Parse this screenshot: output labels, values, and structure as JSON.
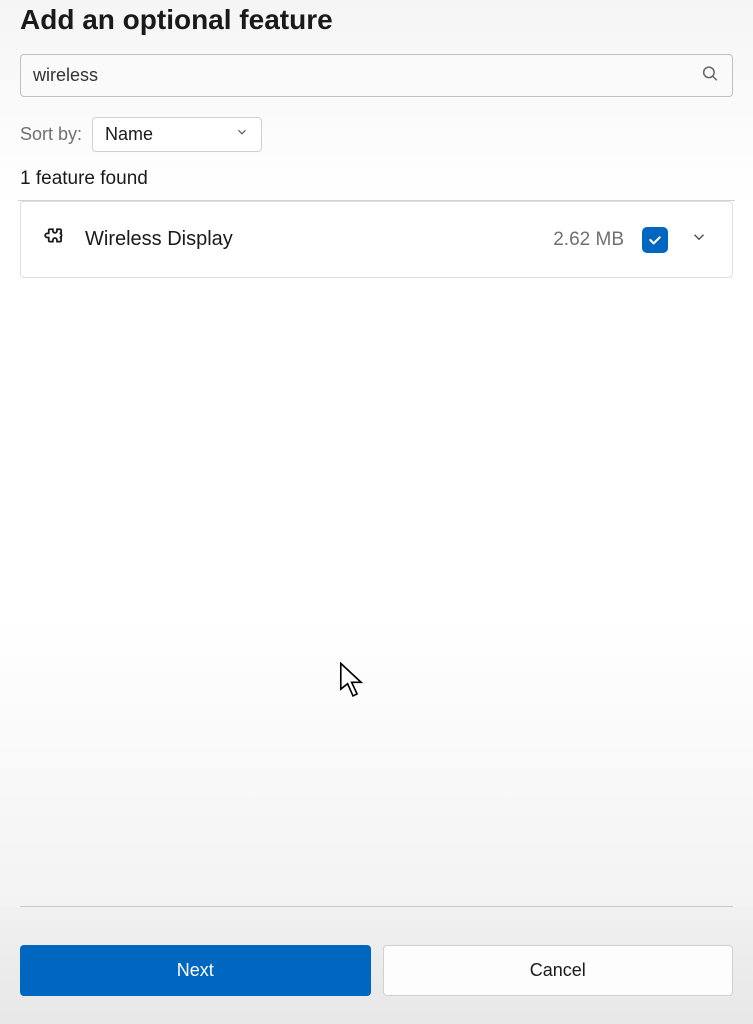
{
  "dialog": {
    "title": "Add an optional feature"
  },
  "search": {
    "value": "wireless"
  },
  "sort": {
    "label": "Sort by:",
    "value": "Name"
  },
  "results": {
    "count_label": "1 feature found",
    "items": [
      {
        "name": "Wireless Display",
        "size": "2.62 MB",
        "checked": true
      }
    ]
  },
  "footer": {
    "next_label": "Next",
    "cancel_label": "Cancel"
  }
}
